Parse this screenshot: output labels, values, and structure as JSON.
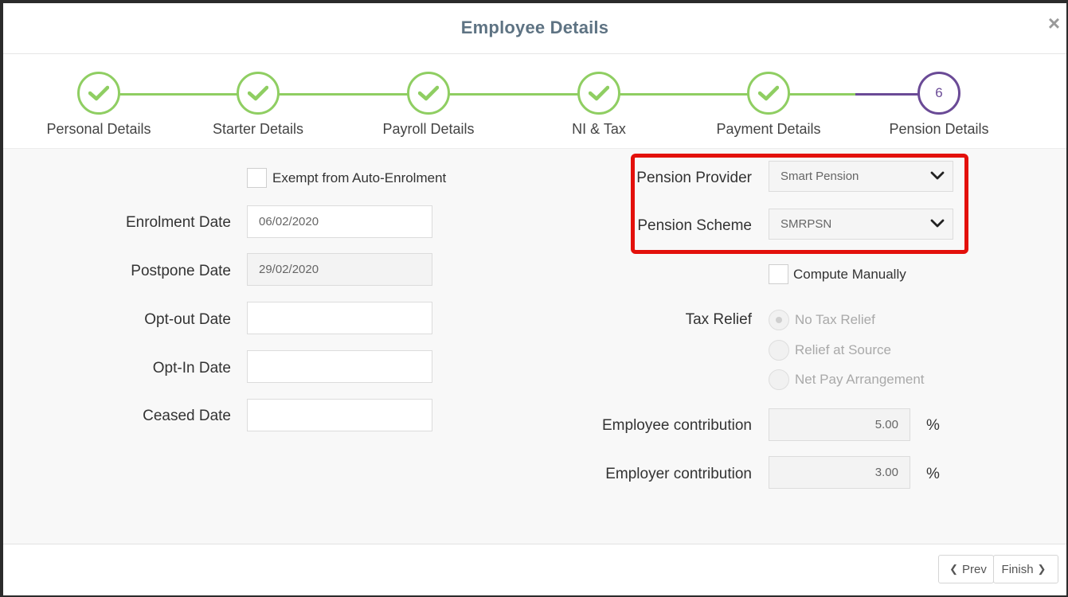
{
  "dialog": {
    "title": "Employee Details",
    "close_icon": "×"
  },
  "steps": [
    {
      "label": "Personal Details",
      "state": "complete"
    },
    {
      "label": "Starter Details",
      "state": "complete"
    },
    {
      "label": "Payroll Details",
      "state": "complete"
    },
    {
      "label": "NI & Tax",
      "state": "complete"
    },
    {
      "label": "Payment Details",
      "state": "complete"
    },
    {
      "label": "Pension Details",
      "state": "active",
      "number": "6"
    }
  ],
  "left": {
    "exempt_label": "Exempt from Auto-Enrolment",
    "enrolment_date": {
      "label": "Enrolment Date",
      "value": "06/02/2020"
    },
    "postpone_date": {
      "label": "Postpone Date",
      "value": "29/02/2020"
    },
    "optout_date": {
      "label": "Opt-out Date",
      "value": ""
    },
    "optin_date": {
      "label": "Opt-In Date",
      "value": ""
    },
    "ceased_date": {
      "label": "Ceased Date",
      "value": ""
    }
  },
  "right": {
    "provider": {
      "label": "Pension Provider",
      "value": "Smart Pension"
    },
    "scheme": {
      "label": "Pension Scheme",
      "value": "SMRPSN"
    },
    "compute_label": "Compute Manually",
    "tax_relief": {
      "label": "Tax Relief",
      "options": [
        "No Tax Relief",
        "Relief at Source",
        "Net Pay Arrangement"
      ],
      "selected": "No Tax Relief"
    },
    "employee_contribution": {
      "label": "Employee contribution",
      "value": "5.00",
      "unit": "%"
    },
    "employer_contribution": {
      "label": "Employer contribution",
      "value": "3.00",
      "unit": "%"
    }
  },
  "footer": {
    "prev_label": "Prev",
    "finish_label": "Finish"
  },
  "colors": {
    "complete": "#8fce62",
    "active": "#6a4a96",
    "highlight": "#e3100b",
    "title": "#5e7383"
  }
}
